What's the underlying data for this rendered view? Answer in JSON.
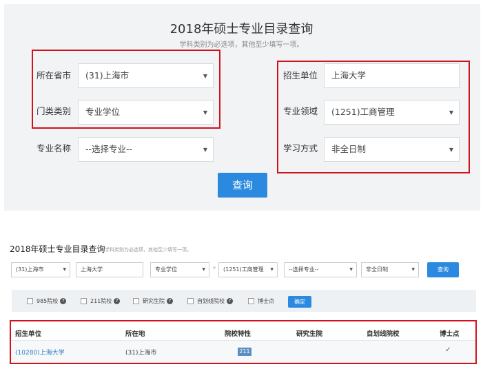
{
  "form1": {
    "title": "2018年硕士专业目录查询",
    "subtitle": "学科类别为必选项，其他至少填写一项。",
    "province_label": "所在省市",
    "province_value": "(31)上海市",
    "category_label": "门类类别",
    "category_value": "专业学位",
    "major_label": "专业名称",
    "major_value": "--选择专业--",
    "school_label": "招生单位",
    "school_value": "上海大学",
    "field_label": "专业领域",
    "field_value": "(1251)工商管理",
    "mode_label": "学习方式",
    "mode_value": "非全日制",
    "query_label": "查询"
  },
  "form2": {
    "title": "2018年硕士专业目录查询",
    "subtitle": "学科类别为必选项，其他至少填写一项。",
    "province": "(31)上海市",
    "school": "上海大学",
    "category": "专业学位",
    "star": "*",
    "field": "(1251)工商管理",
    "major": "--选择专业--",
    "mode": "非全日制",
    "query_label": "查询"
  },
  "filters": {
    "items": [
      "985院校",
      "211院校",
      "研究生院",
      "自划线院校",
      "博士点"
    ],
    "help_glyph": "?",
    "confirm_label": "确定"
  },
  "results": {
    "headers": [
      "招生单位",
      "所在地",
      "院校特性",
      "研究生院",
      "自划线院校",
      "博士点"
    ],
    "row": {
      "school": "(10280)上海大学",
      "location": "(31)上海市",
      "feature": "211",
      "phd": "✓"
    }
  },
  "icons": {
    "dropdown": "▼"
  },
  "colors": {
    "accent": "#2b8ae0",
    "highlight": "#d0121b",
    "link": "#2b7bc4"
  }
}
